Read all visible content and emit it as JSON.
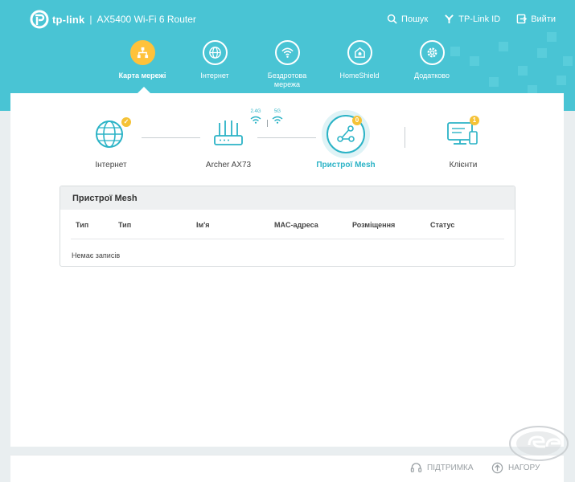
{
  "header": {
    "brand": "tp-link",
    "separator": "|",
    "model": "AX5400 Wi-Fi 6 Router",
    "top_links": {
      "search": "Пошук",
      "tplink_id": "TP-Link ID",
      "logout": "Вийти"
    },
    "nav": [
      {
        "label": "Карта мережі",
        "icon": "network-map-icon",
        "active": true
      },
      {
        "label": "Інтернет",
        "icon": "globe-icon",
        "active": false
      },
      {
        "label": "Бездротова мережа",
        "icon": "wifi-icon",
        "active": false
      },
      {
        "label": "HomeShield",
        "icon": "home-shield-icon",
        "active": false
      },
      {
        "label": "Додатково",
        "icon": "gear-icon",
        "active": false
      }
    ]
  },
  "topology": {
    "internet": {
      "label": "Інтернет",
      "status": "connected"
    },
    "router": {
      "label": "Archer AX73"
    },
    "bands": {
      "band_24": "2.4G",
      "band_5": "5G"
    },
    "mesh": {
      "label": "Пристрої Mesh",
      "count": "0"
    },
    "clients": {
      "label": "Клієнти",
      "count": "1"
    }
  },
  "table": {
    "title": "Пристрої Mesh",
    "columns": [
      "Тип",
      "Тип",
      "Ім'я",
      "MAC-адреса",
      "Розміщення",
      "Статус"
    ],
    "empty_text": "Немає записів"
  },
  "footer": {
    "support": "ПІДТРИМКА",
    "top": "НАГОРУ"
  },
  "colors": {
    "header": "#49c4d4",
    "accent": "#2bb3c6",
    "active_nav": "#fec23b",
    "badge": "#f5c236"
  }
}
